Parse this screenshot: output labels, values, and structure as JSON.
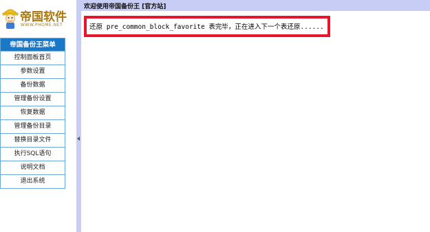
{
  "logo": {
    "title": "帝国软件",
    "subtitle": "WWW.PHOME.NET",
    "mascot_icon": "mascot-icon"
  },
  "menu": {
    "header": "帝国备份王菜单",
    "items": [
      {
        "label": "控制面板首页"
      },
      {
        "label": "参数设置"
      },
      {
        "label": "备份数据"
      },
      {
        "label": "管理备份设置"
      },
      {
        "label": "恢复数据"
      },
      {
        "label": "管理备份目录"
      },
      {
        "label": "替换目录文件"
      },
      {
        "label": "执行SQL语句"
      },
      {
        "label": "说明文档"
      },
      {
        "label": "退出系统"
      }
    ]
  },
  "topbar": {
    "welcome": "欢迎使用帝国备份王 [官方站]"
  },
  "status": {
    "message": "还原 pre_common_block_favorite 表完毕，正在进入下一个表还原......"
  },
  "colors": {
    "menu_header_bg": "#1a78c8",
    "menu_border": "#6aa7d6",
    "frame_bg": "#c7cdf4",
    "alert_border": "#e8142a",
    "logo_color": "#a9780f"
  }
}
